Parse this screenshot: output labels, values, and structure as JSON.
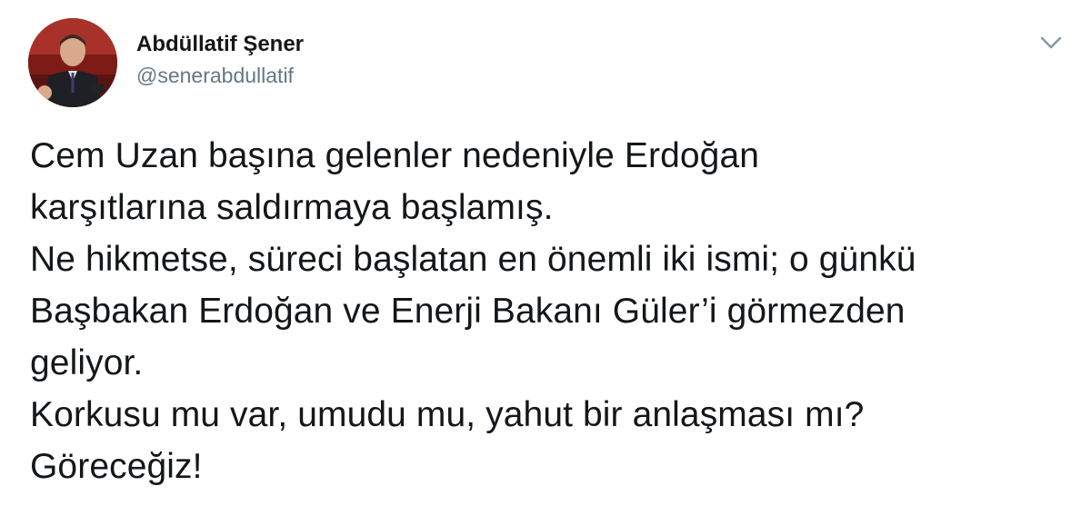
{
  "author": {
    "display_name": "Abdüllatif Şener",
    "handle": "@senerabdullatif",
    "avatar_icon": "profile-photo"
  },
  "menu": {
    "icon": "chevron-down-icon"
  },
  "tweet": {
    "lines": [
      "Cem Uzan başına gelenler nedeniyle Erdoğan",
      "karşıtlarına saldırmaya başlamış.",
      "Ne hikmetse, süreci başlatan en önemli iki ismi; o günkü",
      "Başbakan Erdoğan ve Enerji Bakanı Güler’i görmezden",
      "geliyor.",
      "Korkusu mu var, umudu mu, yahut bir anlaşması mı?",
      "Göreceğiz!"
    ]
  },
  "colors": {
    "text": "#14171a",
    "secondary": "#657786",
    "caret": "#8899a6",
    "avatar_background": "#8a1f1a"
  }
}
